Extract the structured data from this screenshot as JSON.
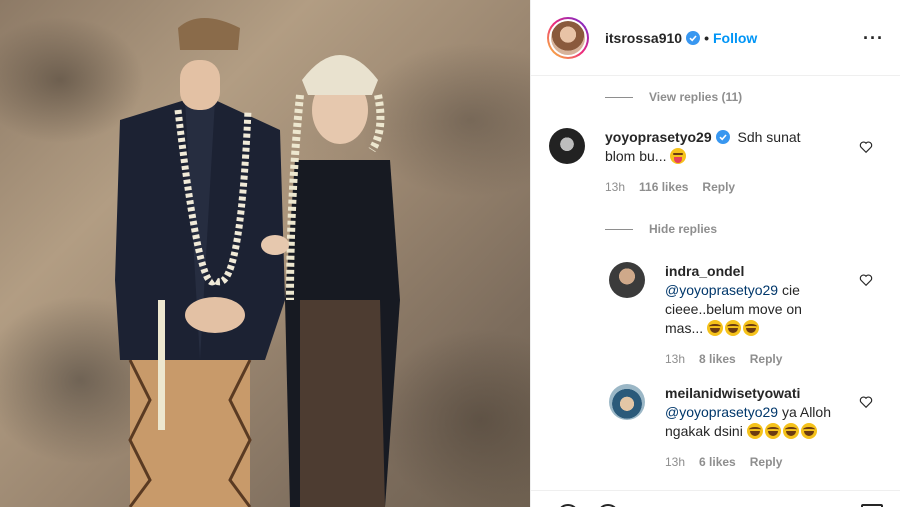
{
  "post": {
    "owner": "itsrossa910",
    "owner_verified": true,
    "follow_label": "Follow",
    "more_icon": "more-horizontal-icon"
  },
  "thread": {
    "view_replies": "View replies (11)",
    "hide_replies": "Hide replies",
    "comment": {
      "username": "yoyoprasetyo29",
      "verified": true,
      "text": "Sdh sunat blom bu...",
      "emoji": "tongue-emoji",
      "time": "13h",
      "likes": "116 likes",
      "reply": "Reply"
    },
    "replies": [
      {
        "username": "indra_ondel",
        "mention": "@yoyoprasetyo29",
        "text": " cie cieee..belum move on mas...",
        "emojis": [
          "laugh-emoji",
          "laugh-emoji",
          "laugh-emoji"
        ],
        "time": "13h",
        "likes": "8 likes",
        "reply": "Reply"
      },
      {
        "username": "meilanidwisetyowati",
        "mention": "@yoyoprasetyo29",
        "text": " ya Alloh ngakak dsini",
        "emojis": [
          "laugh-emoji",
          "laugh-emoji",
          "laugh-emoji",
          "laugh-emoji"
        ],
        "time": "13h",
        "likes": "6 likes",
        "reply": "Reply"
      }
    ]
  },
  "colors": {
    "link_blue": "#0095f6",
    "mention_blue": "#00376b",
    "meta_grey": "#8e8e8e",
    "text": "#262626"
  }
}
